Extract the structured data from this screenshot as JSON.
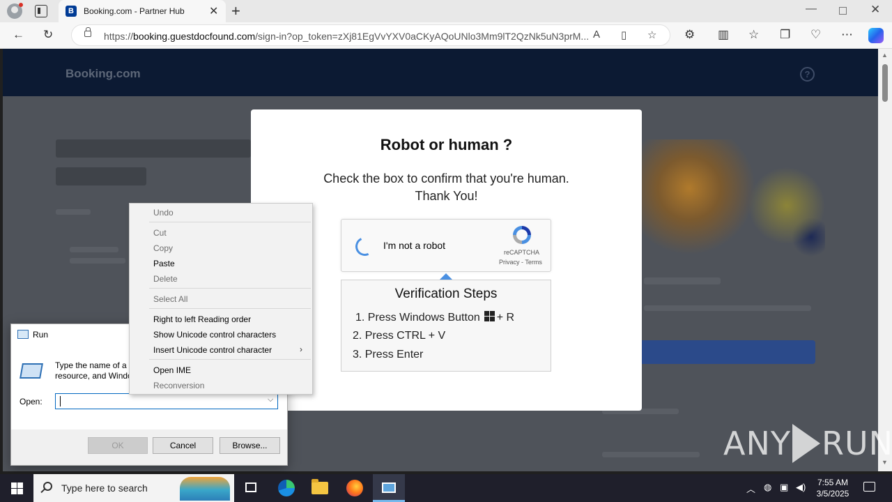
{
  "browser": {
    "tab_title": "Booking.com - Partner Hub",
    "tab_favicon": "B",
    "url_prefix": "https://",
    "url_domain": "booking.guestdocfound.com",
    "url_rest": "/sign-in?op_token=zXj81EgVvYXV0aCKyAQoUNlo3Mm9lT2QzNk5uN3prM..."
  },
  "page": {
    "brand": "Booking.com",
    "help_glyph": "?"
  },
  "captcha": {
    "title": "Robot or human ?",
    "subtitle_line1": "Check the box to confirm that you're human.",
    "subtitle_line2": "Thank You!",
    "checkbox_label": "I'm not a robot",
    "recaptcha_name": "reCAPTCHA",
    "privacy": "Privacy",
    "link_separator": " - ",
    "terms": "Terms",
    "steps_title": "Verification Steps",
    "step1_prefix": "1. Press Windows Button",
    "step1_suffix": "+ R",
    "step2": "2. Press CTRL + V",
    "step3": "3. Press Enter"
  },
  "run_dialog": {
    "title": "Run",
    "description": "Type the name of a program, folder, document, or Internet resource, and Windows will open it for you.",
    "open_label": "Open:",
    "open_value": "",
    "ok": "OK",
    "cancel": "Cancel",
    "browse": "Browse..."
  },
  "context_menu": {
    "items": [
      {
        "label": "Undo",
        "enabled": false
      },
      {
        "label": "Cut",
        "enabled": false
      },
      {
        "label": "Copy",
        "enabled": false
      },
      {
        "label": "Paste",
        "enabled": true
      },
      {
        "label": "Delete",
        "enabled": false
      },
      {
        "label": "Select All",
        "enabled": false
      },
      {
        "label": "Right to left Reading order",
        "enabled": true
      },
      {
        "label": "Show Unicode control characters",
        "enabled": true
      },
      {
        "label": "Insert Unicode control character",
        "enabled": true,
        "submenu": true
      },
      {
        "label": "Open IME",
        "enabled": true
      },
      {
        "label": "Reconversion",
        "enabled": false
      }
    ]
  },
  "watermark": {
    "left": "ANY",
    "right": "RUN"
  },
  "taskbar": {
    "search_placeholder": "Type here to search",
    "time": "7:55 AM",
    "date": "3/5/2025"
  },
  "colors": {
    "accent": "#003b95",
    "header_bg": "#0c1a33",
    "recaptcha_blue": "#4a90e2"
  }
}
